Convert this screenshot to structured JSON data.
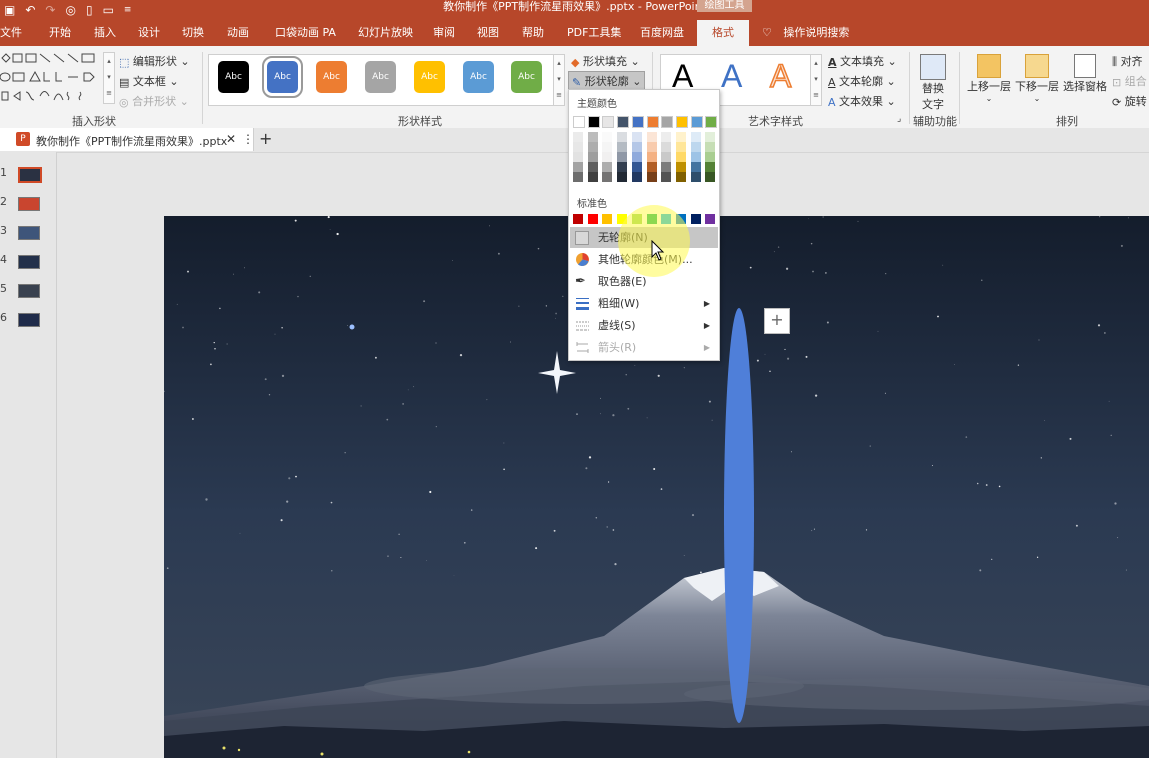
{
  "title_bar": {
    "title": "教你制作《PPT制作流星雨效果》.pptx  -  PowerPoint",
    "tool_tab": "绘图工具",
    "accent": "#b7472a"
  },
  "tabs": [
    "文件",
    "开始",
    "插入",
    "设计",
    "切换",
    "动画",
    "口袋动画 PA",
    "幻灯片放映",
    "审阅",
    "视图",
    "帮助",
    "PDF工具集",
    "百度网盘",
    "格式"
  ],
  "tell_me": "操作说明搜索",
  "ribbon": {
    "insert_shapes": {
      "label": "插入形状",
      "edit_shape": "编辑形状",
      "text_box": "文本框",
      "merge_shapes": "合并形状"
    },
    "shape_styles": {
      "label": "形状样式",
      "swatch_text": "Abc",
      "swatch_colors": [
        "#000000",
        "#4472c4",
        "#ed7d31",
        "#a5a5a5",
        "#ffc000",
        "#5b9bd5",
        "#70ad47"
      ],
      "shape_fill": "形状填充",
      "shape_outline": "形状轮廓"
    },
    "wordart": {
      "label": "艺术字样式",
      "glyph": "A",
      "text_fill": "文本填充",
      "text_outline": "文本轮廓",
      "text_effects": "文本效果"
    },
    "accessibility": {
      "label": "辅助功能",
      "alt_text_line1": "替换",
      "alt_text_line2": "文字"
    },
    "arrange": {
      "label": "排列",
      "bring_forward": "上移一层",
      "send_backward": "下移一层",
      "selection_pane": "选择窗格",
      "align": "对齐",
      "group": "组合",
      "rotate": "旋转"
    }
  },
  "doc_tab": {
    "name": "教你制作《PPT制作流星雨效果》.pptx",
    "add": "+"
  },
  "thumbnails": [
    "1",
    "2",
    "3",
    "4",
    "5",
    "6"
  ],
  "dropdown": {
    "theme_colors_label": "主题颜色",
    "standard_colors_label": "标准色",
    "theme_top_row": [
      "#ffffff",
      "#000000",
      "#e7e6e6",
      "#44546a",
      "#4472c4",
      "#ed7d31",
      "#a5a5a5",
      "#ffc000",
      "#5b9bd5",
      "#70ad47"
    ],
    "standard_colors": [
      "#c00000",
      "#ff0000",
      "#ffc000",
      "#ffff00",
      "#92d050",
      "#00b050",
      "#00b0f0",
      "#0070c0",
      "#002060",
      "#7030a0"
    ],
    "items": [
      {
        "label": "无轮廓(N)"
      },
      {
        "label": "其他轮廓颜色(M)..."
      },
      {
        "label": "取色器(E)"
      },
      {
        "label": "粗细(W)"
      },
      {
        "label": "虚线(S)"
      },
      {
        "label": "箭头(R)"
      }
    ]
  },
  "slide": {
    "ellipse_color": "#4f7fd9"
  }
}
